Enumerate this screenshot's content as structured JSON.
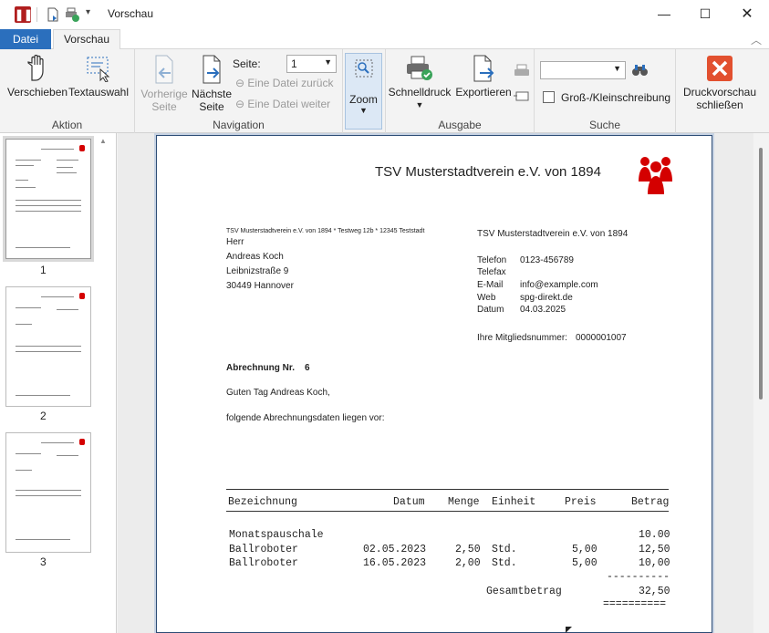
{
  "window": {
    "title": "Vorschau"
  },
  "tabs": {
    "file": "Datei",
    "preview": "Vorschau"
  },
  "ribbon": {
    "groups": {
      "action": "Aktion",
      "navigation": "Navigation",
      "output": "Ausgabe",
      "search": "Suche"
    },
    "action": {
      "move": "Verschieben",
      "text_select": "Textauswahl"
    },
    "navigation": {
      "prev_line1": "Vorherige",
      "prev_line2": "Seite",
      "next_line1": "Nächste",
      "next_line2": "Seite",
      "page_label": "Seite:",
      "page_value": "1",
      "file_back": "Eine Datei zurück",
      "file_forward": "Eine Datei weiter"
    },
    "zoom": "Zoom",
    "output": {
      "quickprint": "Schnelldruck",
      "export": "Exportieren"
    },
    "search": {
      "case": "Groß-/Kleinschreibung",
      "value": ""
    },
    "close_line1": "Druckvorschau",
    "close_line2": "schließen"
  },
  "thumbnails": [
    "1",
    "2",
    "3"
  ],
  "document": {
    "club": "TSV Musterstadtverein e.V. von 1894",
    "sender_line": "TSV Musterstadtverein e.V. von 1894 * Testweg 12b * 12345 Teststadt",
    "recipient": {
      "salutation": "Herr",
      "name": "Andreas Koch",
      "street": "Leibnizstraße 9",
      "city": "30449 Hannover"
    },
    "info": {
      "club": "TSV Musterstadtverein e.V. von 1894",
      "phone_label": "Telefon",
      "phone": "0123-456789",
      "fax_label": "Telefax",
      "fax": "",
      "email_label": "E-Mail",
      "email": "info@example.com",
      "web_label": "Web",
      "web": "spg-direkt.de",
      "date_label": "Datum",
      "date": "04.03.2025",
      "member_label": "Ihre Mitgliedsnummer:",
      "member_no": "0000001007"
    },
    "billing_label": "Abrechnung Nr.",
    "billing_no": "6",
    "greeting": "Guten Tag Andreas Koch,",
    "intro": "folgende Abrechnungsdaten liegen vor:",
    "table": {
      "headers": [
        "Bezeichnung",
        "Datum",
        "Menge",
        "Einheit",
        "Preis",
        "Betrag"
      ],
      "rows": [
        [
          "Monatspauschale",
          "",
          "",
          "",
          "",
          "10.00"
        ],
        [
          "Ballroboter",
          "02.05.2023",
          "2,50",
          "Std.",
          "5,00",
          "12,50"
        ],
        [
          "Ballroboter",
          "16.05.2023",
          "2,00",
          "Std.",
          "5,00",
          "10,00"
        ]
      ],
      "sum_line": "----------",
      "total_label": "Gesamtbetrag",
      "total": "32,50",
      "double_line": "=========="
    }
  }
}
